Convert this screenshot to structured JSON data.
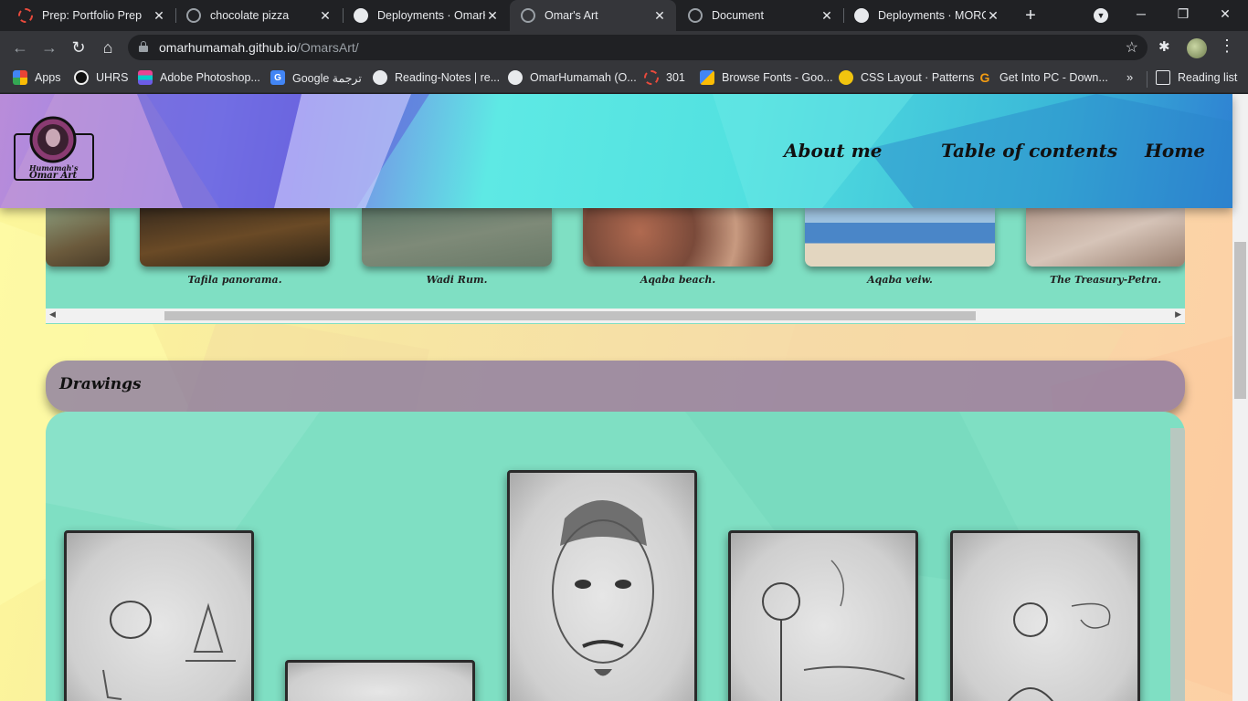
{
  "browser": {
    "tabs": [
      {
        "title": "Prep: Portfolio Prep",
        "favicon": "red-circle-icon",
        "active": false
      },
      {
        "title": "chocolate pizza",
        "favicon": "globe-icon",
        "active": false
      },
      {
        "title": "Deployments · OmarH",
        "favicon": "github-icon",
        "active": false
      },
      {
        "title": "Omar's Art",
        "favicon": "globe-icon",
        "active": true
      },
      {
        "title": "Document",
        "favicon": "globe-icon",
        "active": false
      },
      {
        "title": "Deployments · MORO",
        "favicon": "github-icon",
        "active": false
      }
    ],
    "url_host": "omarhumamah.github.io",
    "url_path": "/OmarsArt/",
    "bookmarks": [
      {
        "label": "Apps",
        "icon": "apps-grid-icon"
      },
      {
        "label": "UHRS",
        "icon": "uhrs-icon"
      },
      {
        "label": "Adobe Photoshop...",
        "icon": "photoshop-icon"
      },
      {
        "label": "Google ترجمة",
        "icon": "google-translate-icon"
      },
      {
        "label": "Reading-Notes | re...",
        "icon": "globe-icon"
      },
      {
        "label": "OmarHumamah (O...",
        "icon": "github-icon"
      },
      {
        "label": "301",
        "icon": "red-circle-icon"
      },
      {
        "label": "Browse Fonts - Goo...",
        "icon": "google-fonts-icon"
      },
      {
        "label": "CSS Layout · Patterns",
        "icon": "css-layout-icon"
      },
      {
        "label": "Get Into PC - Down...",
        "icon": "g-icon"
      }
    ],
    "more_bookmarks": "»",
    "reading_list": "Reading list"
  },
  "site": {
    "logo_text_top": "Humamah's",
    "logo_text_bottom": "Omar Art",
    "nav": [
      "About me",
      "Table of contents",
      "Home"
    ]
  },
  "photos": {
    "captions": [
      "Tafila panorama.",
      "Wadi Rum.",
      "Aqaba beach.",
      "Aqaba veiw.",
      "The Treasury-Petra."
    ]
  },
  "drawings": {
    "title": "Drawings"
  },
  "colors": {
    "page_bg": "#fdf89a",
    "panel_teal": "#7fdfc3",
    "section_title_bg": "#7e6ea0"
  }
}
